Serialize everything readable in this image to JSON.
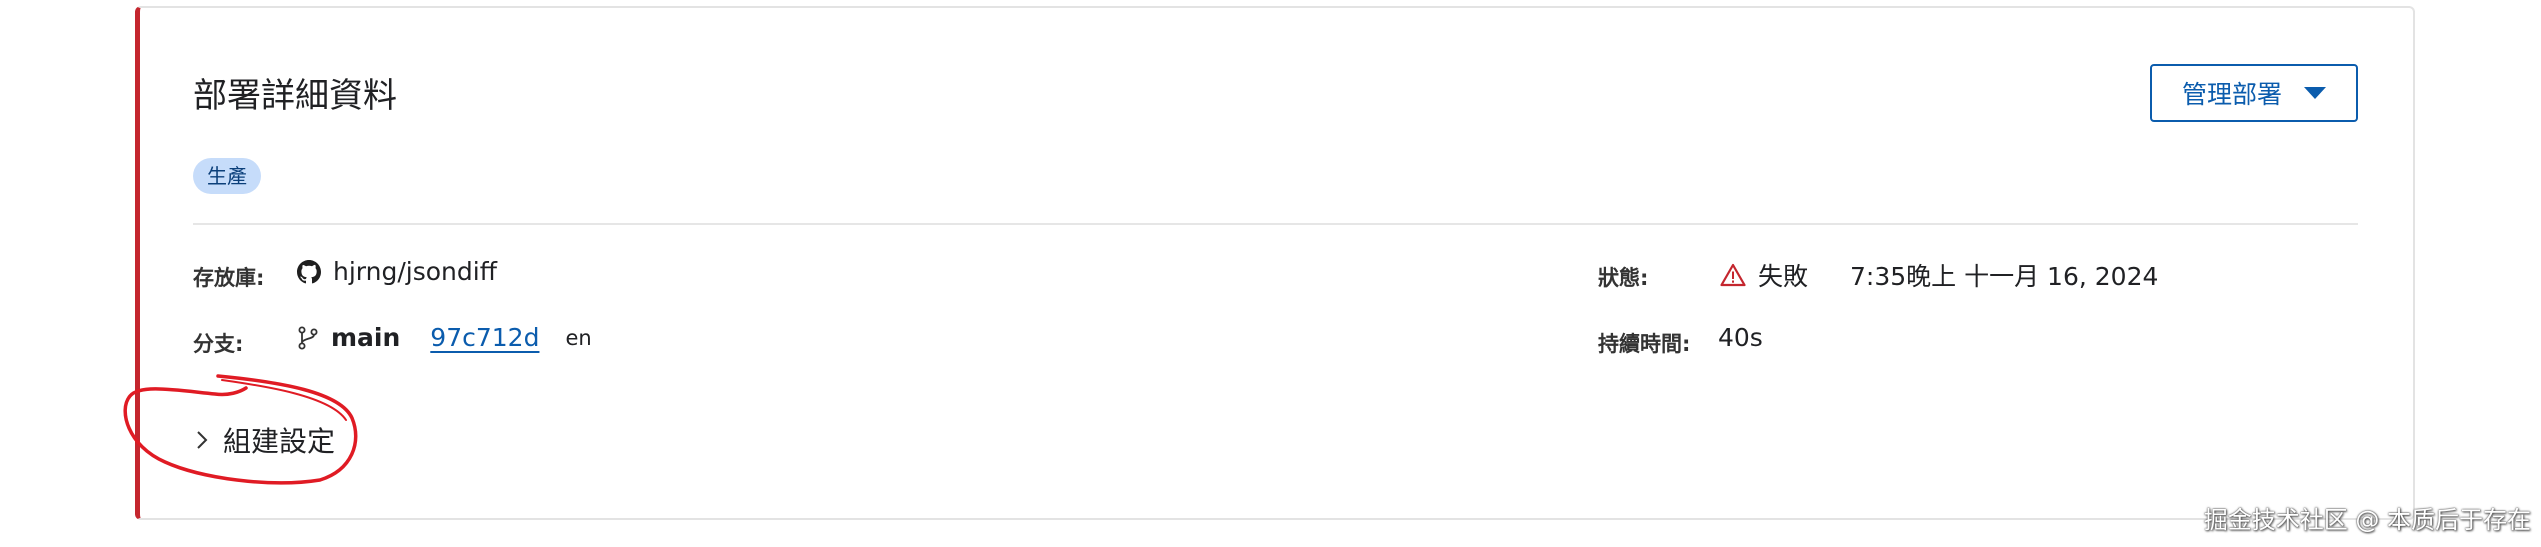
{
  "deployment": {
    "title": "部署詳細資料",
    "manage_button_label": "管理部署",
    "environment_badge": "生產",
    "repository": {
      "label": "存放庫:",
      "value": "hjrng/jsondiff",
      "icon": "github-icon"
    },
    "branch": {
      "label": "分支:",
      "name": "main",
      "commit": "97c712d",
      "language": "en",
      "icon": "git-branch-icon"
    },
    "status": {
      "label": "狀態:",
      "value": "失敗",
      "timestamp": "7:35晚上 十一月 16, 2024",
      "icon": "warning-triangle-icon"
    },
    "duration": {
      "label": "持續時間:",
      "value": "40s"
    },
    "build_settings": {
      "label": "組建設定",
      "icon": "chevron-right-icon"
    }
  },
  "accent_colors": {
    "card_left_border": "#c4262e",
    "primary": "#0b5cad",
    "badge_bg": "#c6dcfa",
    "annotation": "#e01b24"
  },
  "watermark": "掘金技术社区 @ 本质后于存在"
}
